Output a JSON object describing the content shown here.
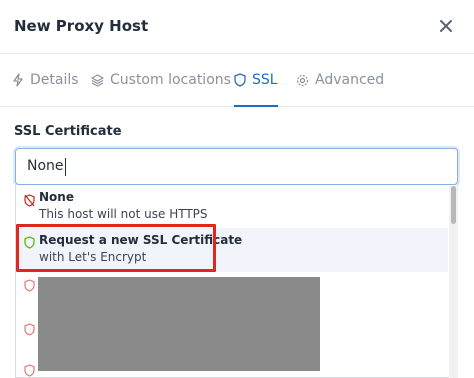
{
  "dialog": {
    "title": "New Proxy Host"
  },
  "tabs": [
    {
      "label": "Details",
      "icon": "bolt-icon",
      "active": false
    },
    {
      "label": "Custom locations",
      "icon": "layers-icon",
      "active": false
    },
    {
      "label": "SSL",
      "icon": "shield-icon",
      "active": true
    },
    {
      "label": "Advanced",
      "icon": "gear-icon",
      "active": false
    }
  ],
  "ssl": {
    "field_label": "SSL Certificate",
    "input_value": "None",
    "options": [
      {
        "title": "None",
        "subtitle": "This host will not use HTTPS",
        "icon": "shield-off-icon",
        "icon_color": "#cd201f"
      },
      {
        "title": "Request a new SSL Certificate",
        "subtitle": "with Let's Encrypt",
        "icon": "shield-icon",
        "icon_color": "#5eba00"
      }
    ]
  },
  "colors": {
    "accent": "#206bc4",
    "highlight_box": "#e0271c",
    "redacted": "#8a8a8a"
  }
}
